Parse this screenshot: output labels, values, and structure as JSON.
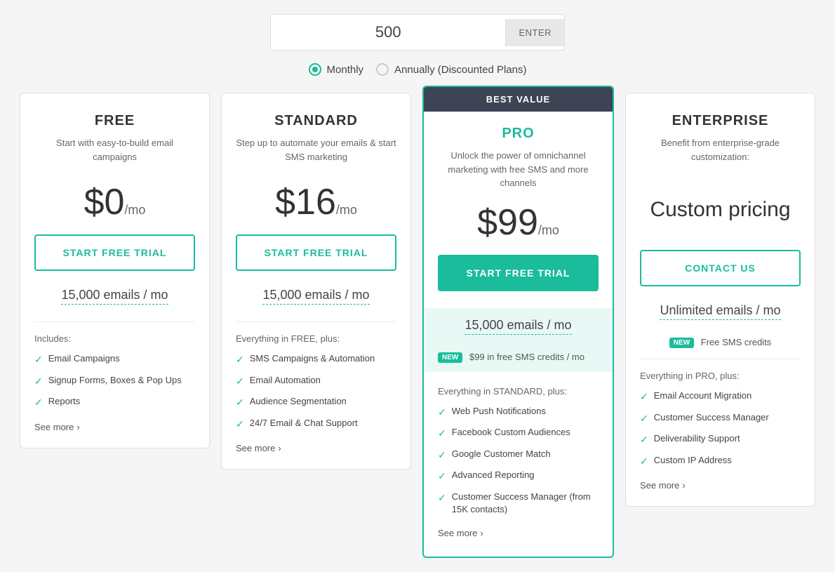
{
  "top": {
    "contacts_value": "500",
    "enter_label": "ENTER",
    "billing_monthly_label": "Monthly",
    "billing_annually_label": "Annually (Discounted Plans)",
    "monthly_selected": true
  },
  "plans": [
    {
      "id": "free",
      "name": "FREE",
      "desc": "Start with easy-to-build email campaigns",
      "price": "$0",
      "price_suffix": "/mo",
      "cta": "START FREE TRIAL",
      "emails": "15,000 emails / mo",
      "emails_note": null,
      "includes_label": "Includes:",
      "features": [
        "Email Campaigns",
        "Signup Forms, Boxes & Pop Ups",
        "Reports"
      ],
      "see_more": "See more",
      "best_value": false,
      "pro": false,
      "enterprise": false
    },
    {
      "id": "standard",
      "name": "STANDARD",
      "desc": "Step up to automate your emails & start SMS marketing",
      "price": "$16",
      "price_suffix": "/mo",
      "cta": "START FREE TRIAL",
      "emails": "15,000 emails / mo",
      "emails_note": null,
      "includes_label": "Everything in FREE, plus:",
      "features": [
        "SMS Campaigns & Automation",
        "Email Automation",
        "Audience Segmentation",
        "24/7 Email & Chat Support"
      ],
      "see_more": "See more",
      "best_value": false,
      "pro": false,
      "enterprise": false
    },
    {
      "id": "pro",
      "name": "PRO",
      "desc": "Unlock the power of omnichannel marketing with free SMS and more channels",
      "price": "$99",
      "price_suffix": "/mo",
      "cta": "START FREE TRIAL",
      "emails": "15,000 emails / mo",
      "emails_note": "$99 in free SMS credits / mo",
      "includes_label": "Everything in STANDARD, plus:",
      "features": [
        "Web Push Notifications",
        "Facebook Custom Audiences",
        "Google Customer Match",
        "Advanced Reporting",
        "Customer Success Manager (from 15K contacts)"
      ],
      "see_more": "See more",
      "best_value": true,
      "best_value_label": "BEST VALUE",
      "pro": true,
      "enterprise": false
    },
    {
      "id": "enterprise",
      "name": "ENTERPRISE",
      "desc": "Benefit from enterprise-grade customization:",
      "price": null,
      "custom_pricing": "Custom pricing",
      "cta": "CONTACT US",
      "emails": "Unlimited emails / mo",
      "emails_note": "Free SMS credits",
      "includes_label": "Everything in PRO, plus:",
      "features": [
        "Email Account Migration",
        "Customer Success Manager",
        "Deliverability Support",
        "Custom IP Address"
      ],
      "see_more": "See more",
      "best_value": false,
      "pro": false,
      "enterprise": true
    }
  ]
}
